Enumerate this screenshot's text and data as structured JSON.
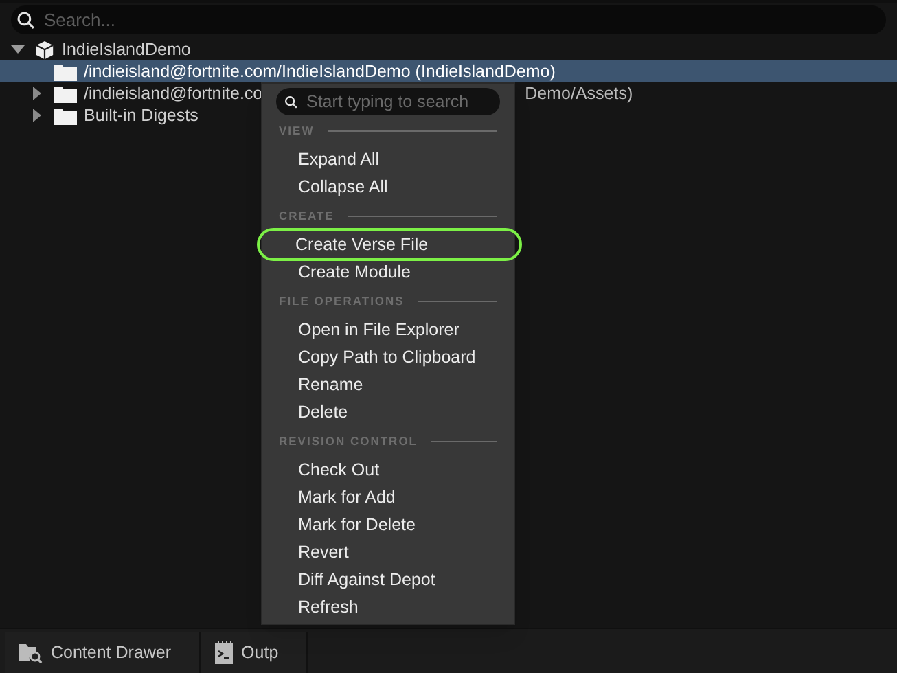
{
  "search": {
    "placeholder": "Search..."
  },
  "tree": [
    {
      "label": "IndieIslandDemo",
      "expanded": true,
      "selected": false,
      "children": [
        {
          "label": "/indieisland@fortnite.com/IndieIslandDemo (IndieIslandDemo)",
          "selected": true
        },
        {
          "label": "/indieisland@fortnite.co",
          "label_after_menu": "Demo/Assets)",
          "expanded": false,
          "selected": false
        },
        {
          "label": "Built-in Digests",
          "expanded": false,
          "selected": false
        }
      ]
    }
  ],
  "context_menu": {
    "search_placeholder": "Start typing to search",
    "sections": [
      {
        "heading": "VIEW",
        "items": [
          {
            "label": "Expand All",
            "highlighted": false
          },
          {
            "label": "Collapse All",
            "highlighted": false
          }
        ]
      },
      {
        "heading": "CREATE",
        "items": [
          {
            "label": "Create Verse File",
            "highlighted": true
          },
          {
            "label": "Create Module",
            "highlighted": false
          }
        ]
      },
      {
        "heading": "FILE OPERATIONS",
        "items": [
          {
            "label": "Open in File Explorer",
            "highlighted": false
          },
          {
            "label": "Copy Path to Clipboard",
            "highlighted": false
          },
          {
            "label": "Rename",
            "highlighted": false
          },
          {
            "label": "Delete",
            "highlighted": false
          }
        ]
      },
      {
        "heading": "REVISION CONTROL",
        "items": [
          {
            "label": "Check Out",
            "highlighted": false
          },
          {
            "label": "Mark for Add",
            "highlighted": false
          },
          {
            "label": "Mark for Delete",
            "highlighted": false
          },
          {
            "label": "Revert",
            "highlighted": false
          },
          {
            "label": "Diff Against Depot",
            "highlighted": false
          },
          {
            "label": "Refresh",
            "highlighted": false
          }
        ]
      }
    ]
  },
  "bottom_tabs": [
    {
      "label": "Content Drawer"
    },
    {
      "label": "Outp"
    }
  ]
}
